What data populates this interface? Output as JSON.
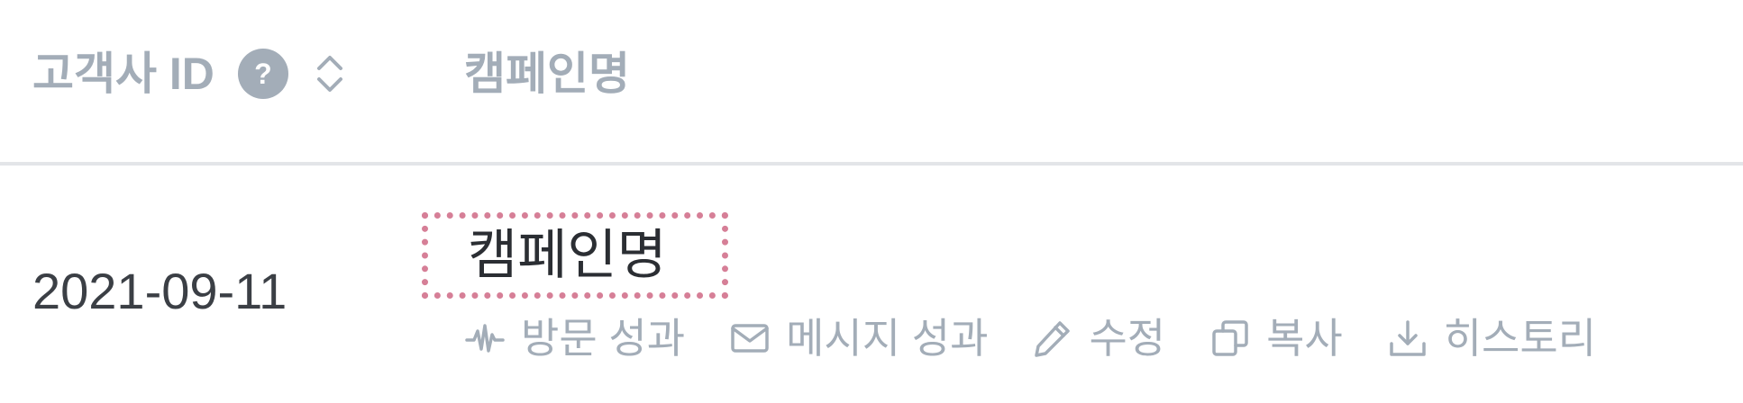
{
  "table": {
    "columns": {
      "customer_id": "고객사 ID",
      "help_glyph": "?",
      "campaign_name": "캠페인명"
    },
    "row": {
      "date": "2021-09-11",
      "campaign_name": "캠페인명",
      "actions": [
        {
          "label": "방문 성과",
          "icon": "activity-icon"
        },
        {
          "label": "메시지 성과",
          "icon": "envelope-icon"
        },
        {
          "label": "수정",
          "icon": "pencil-icon"
        },
        {
          "label": "복사",
          "icon": "copy-icon"
        },
        {
          "label": "히스토리",
          "icon": "download-icon"
        }
      ]
    }
  },
  "colors": {
    "muted_text": "#a3adb8",
    "body_text": "#3b3f45",
    "focus_outline": "#d67f97",
    "divider": "#e3e5e8"
  }
}
